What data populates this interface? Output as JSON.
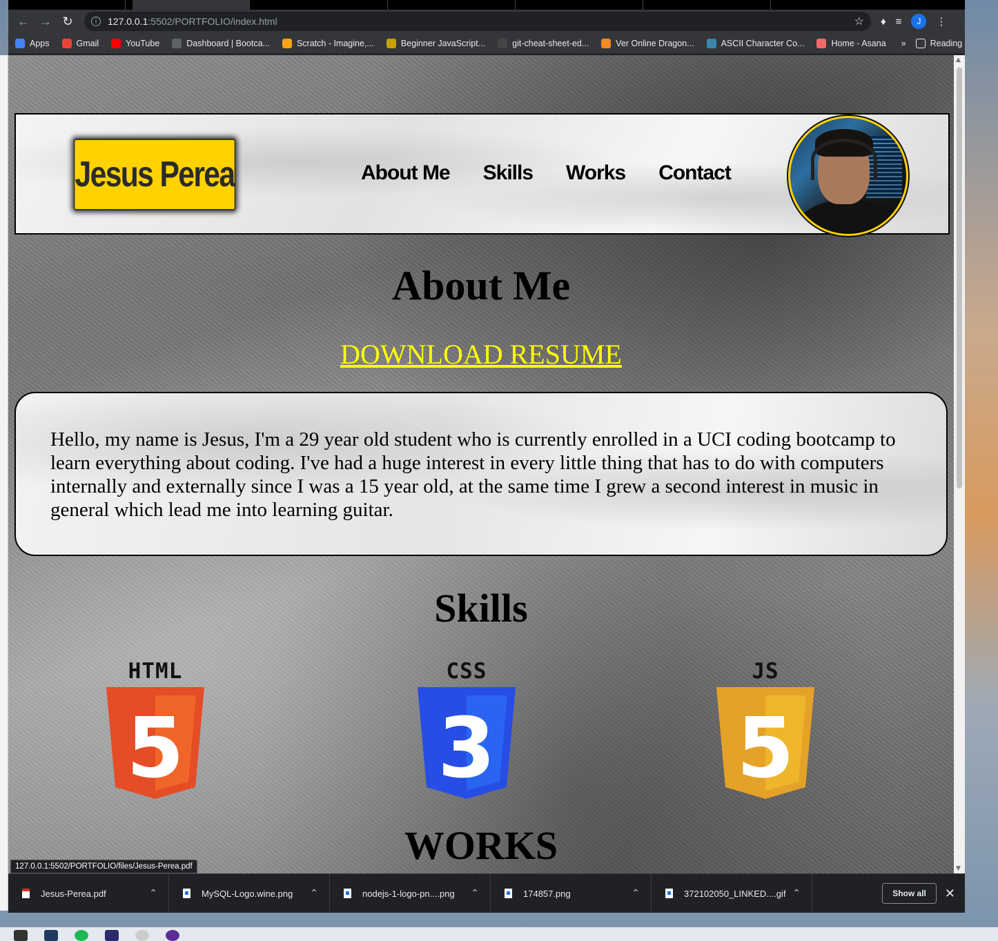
{
  "browser": {
    "url_host": "127.0.0.1",
    "url_path": ":5502/PORTFOLIO/index.html",
    "profile_initial": "J",
    "bookmarks": [
      {
        "label": "Apps",
        "color": "#4285f4",
        "icon": "apps-grid-icon"
      },
      {
        "label": "Gmail",
        "color": "#ea4335",
        "icon": "gmail-icon"
      },
      {
        "label": "YouTube",
        "color": "#ff0000",
        "icon": "youtube-icon"
      },
      {
        "label": "Dashboard | Bootca...",
        "color": "#5f6368",
        "icon": "globe-icon"
      },
      {
        "label": "Scratch - Imagine,...",
        "color": "#f7a21b",
        "icon": "scratch-icon"
      },
      {
        "label": "Beginner JavaScript...",
        "color": "#c8a000",
        "icon": "crown-icon"
      },
      {
        "label": "git-cheat-sheet-ed...",
        "color": "#444444",
        "icon": "github-icon"
      },
      {
        "label": "Ver Online Dragon...",
        "color": "#f08a24",
        "icon": "dragonball-icon"
      },
      {
        "label": "ASCII Character Co...",
        "color": "#3a87ad",
        "icon": "ascii-icon"
      },
      {
        "label": "Home - Asana",
        "color": "#f06a6a",
        "icon": "asana-icon"
      }
    ],
    "bookmarks_more": "»",
    "reading_list": "Reading list",
    "status_url": "127.0.0.1:5502/PORTFOLIO/files/Jesus-Perea.pdf"
  },
  "page": {
    "brand_name": "Jesus Perea",
    "nav": [
      "About Me",
      "Skills",
      "Works",
      "Contact"
    ],
    "about_title": "About Me",
    "resume_link": "DOWNLOAD RESUME",
    "about_text": "Hello, my name is Jesus, I'm a 29 year old student who is currently enrolled in a UCI coding bootcamp to learn everything about coding. I've had a huge interest in every little thing that has to do with computers internally and externally since I was a 15 year old, at the same time I grew a second interest in music in general which lead me into learning guitar.",
    "skills_title": "Skills",
    "skills": [
      {
        "label": "HTML",
        "digit": "5",
        "color": "#e44d26",
        "shade": "#f16529",
        "icon": "html5-logo-icon"
      },
      {
        "label": "CSS",
        "digit": "3",
        "color": "#264de4",
        "shade": "#2965f1",
        "icon": "css3-logo-icon"
      },
      {
        "label": "JS",
        "digit": "5",
        "color": "#e5a228",
        "shade": "#efb62c",
        "icon": "javascript-logo-icon"
      }
    ],
    "works_title": "WORKS"
  },
  "downloads": {
    "items": [
      "Jesus-Perea.pdf",
      "MySQL-Logo.wine.png",
      "nodejs-1-logo-pn....png",
      "174857.png",
      "372102050_LINKED....gif"
    ],
    "show_all": "Show all"
  }
}
